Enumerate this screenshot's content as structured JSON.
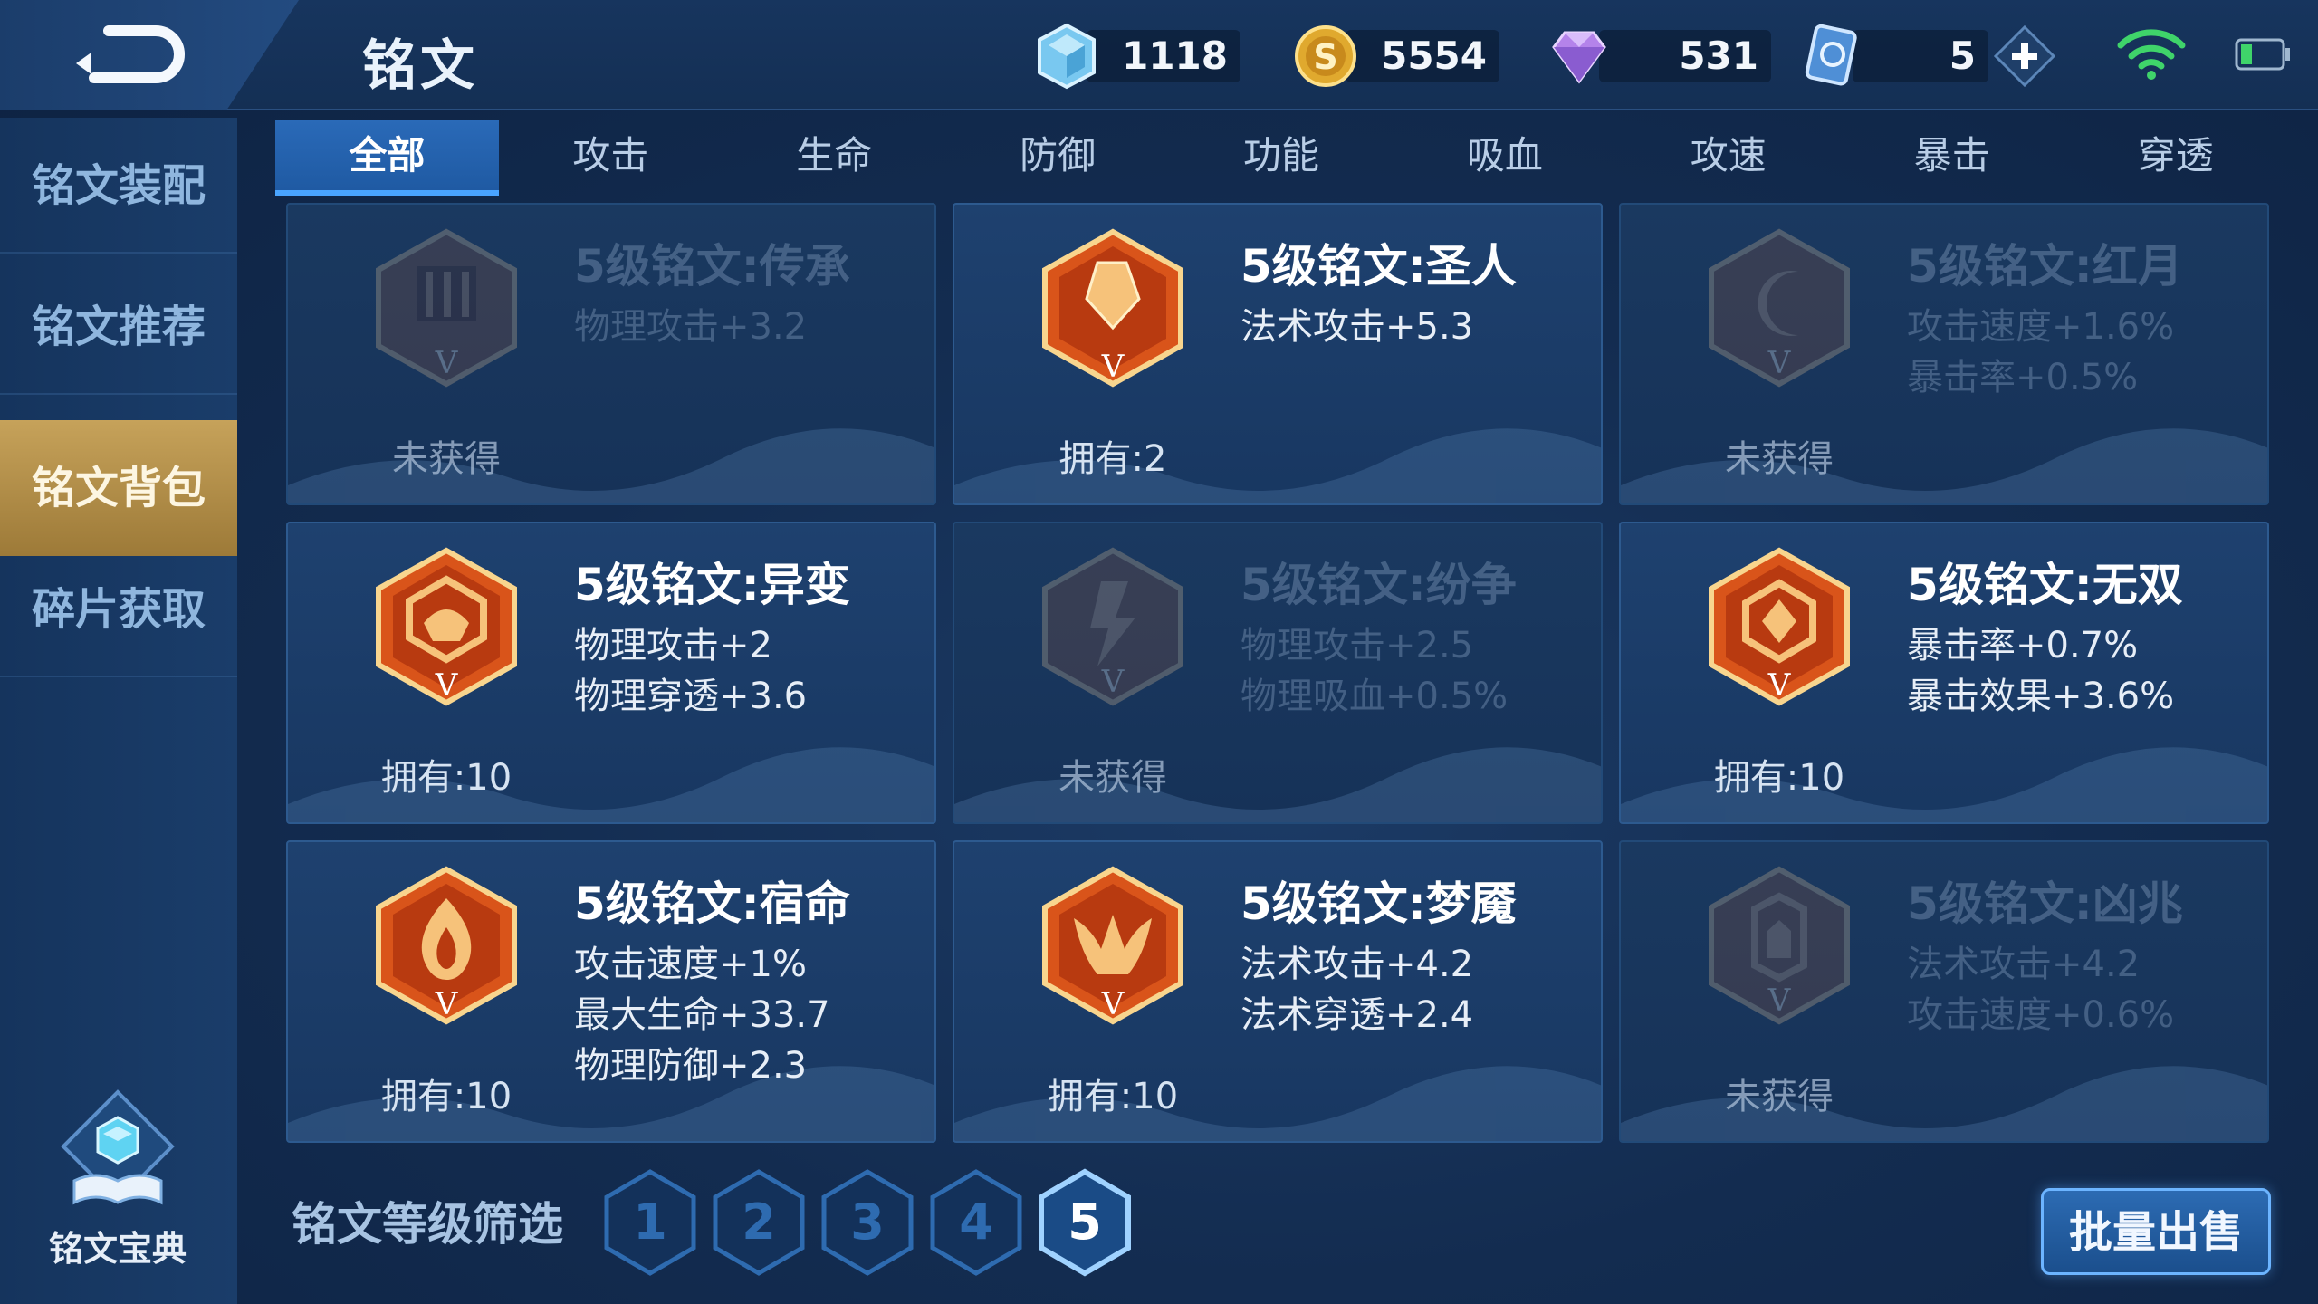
{
  "header": {
    "title": "铭文",
    "back_icon": "back-arrow-icon",
    "currencies": [
      {
        "icon": "crystal-icon",
        "value": "1118"
      },
      {
        "icon": "gold-coin-icon",
        "value": "5554"
      },
      {
        "icon": "diamond-icon",
        "value": "531"
      },
      {
        "icon": "ticket-icon",
        "value": "5"
      }
    ],
    "add_icon": "plus-icon",
    "wifi_icon": "wifi-icon",
    "battery_icon": "battery-icon"
  },
  "tabs": [
    {
      "label": "全部",
      "active": true
    },
    {
      "label": "攻击"
    },
    {
      "label": "生命"
    },
    {
      "label": "防御"
    },
    {
      "label": "功能"
    },
    {
      "label": "吸血"
    },
    {
      "label": "攻速"
    },
    {
      "label": "暴击"
    },
    {
      "label": "穿透"
    }
  ],
  "sidebar": {
    "items": [
      {
        "label": "铭文装配"
      },
      {
        "label": "铭文推荐"
      },
      {
        "label": "铭文背包",
        "active": true
      },
      {
        "label": "碎片获取"
      }
    ],
    "codex_label": "铭文宝典",
    "codex_icon": "book-icon"
  },
  "cards": [
    {
      "name": "5级铭文:传承",
      "attrs": [
        "物理攻击+3.2"
      ],
      "owned": "未获得",
      "locked": true
    },
    {
      "name": "5级铭文:圣人",
      "attrs": [
        "法术攻击+5.3"
      ],
      "owned": "拥有:2",
      "locked": false
    },
    {
      "name": "5级铭文:红月",
      "attrs": [
        "攻击速度+1.6%",
        "暴击率+0.5%"
      ],
      "owned": "未获得",
      "locked": true
    },
    {
      "name": "5级铭文:异变",
      "attrs": [
        "物理攻击+2",
        "物理穿透+3.6"
      ],
      "owned": "拥有:10",
      "locked": false
    },
    {
      "name": "5级铭文:纷争",
      "attrs": [
        "物理攻击+2.5",
        "物理吸血+0.5%"
      ],
      "owned": "未获得",
      "locked": true
    },
    {
      "name": "5级铭文:无双",
      "attrs": [
        "暴击率+0.7%",
        "暴击效果+3.6%"
      ],
      "owned": "拥有:10",
      "locked": false
    },
    {
      "name": "5级铭文:宿命",
      "attrs": [
        "攻击速度+1%",
        "最大生命+33.7",
        "物理防御+2.3"
      ],
      "owned": "拥有:10",
      "locked": false
    },
    {
      "name": "5级铭文:梦魇",
      "attrs": [
        "法术攻击+4.2",
        "法术穿透+2.4"
      ],
      "owned": "拥有:10",
      "locked": false
    },
    {
      "name": "5级铭文:凶兆",
      "attrs": [
        "法术攻击+4.2",
        "攻击速度+0.6%"
      ],
      "owned": "未获得",
      "locked": true
    }
  ],
  "filter": {
    "label": "铭文等级筛选",
    "levels": [
      "1",
      "2",
      "3",
      "4",
      "5"
    ],
    "selected": "5"
  },
  "batch_sell_label": "批量出售",
  "colors": {
    "accent_blue": "#49a4ff",
    "gold_active": "#c6a25a",
    "rune_orange": "#e0621e"
  }
}
